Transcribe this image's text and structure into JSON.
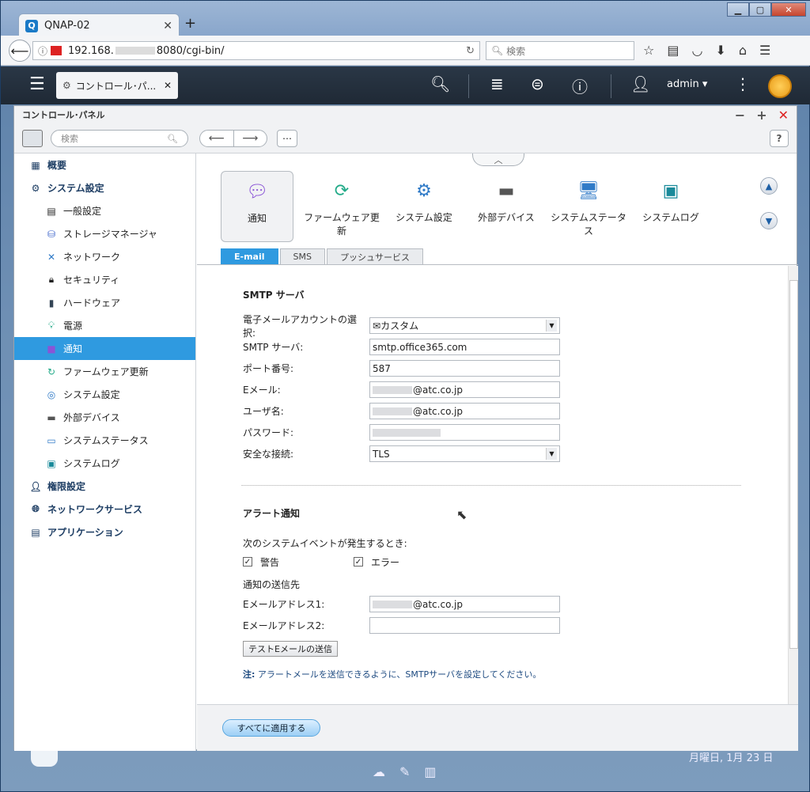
{
  "browser": {
    "tab_title": "QNAP-02",
    "url_prefix": "192.168.",
    "url_suffix": "8080/cgi-bin/",
    "search_placeholder": "検索"
  },
  "qnap": {
    "app_tab": "コントロール･パ...",
    "user": "admin ▾"
  },
  "window": {
    "title": "コントロール･パネル",
    "search_placeholder": "検索"
  },
  "sidebar": {
    "items": [
      {
        "label": "概要",
        "level": "top"
      },
      {
        "label": "システム設定",
        "level": "top"
      },
      {
        "label": "一般設定",
        "level": "sub"
      },
      {
        "label": "ストレージマネージャ",
        "level": "sub"
      },
      {
        "label": "ネットワーク",
        "level": "sub"
      },
      {
        "label": "セキュリティ",
        "level": "sub"
      },
      {
        "label": "ハードウェア",
        "level": "sub"
      },
      {
        "label": "電源",
        "level": "sub"
      },
      {
        "label": "通知",
        "level": "sub",
        "active": true
      },
      {
        "label": "ファームウェア更新",
        "level": "sub"
      },
      {
        "label": "システム設定",
        "level": "sub"
      },
      {
        "label": "外部デバイス",
        "level": "sub"
      },
      {
        "label": "システムステータス",
        "level": "sub"
      },
      {
        "label": "システムログ",
        "level": "sub"
      },
      {
        "label": "権限設定",
        "level": "top"
      },
      {
        "label": "ネットワークサービス",
        "level": "top"
      },
      {
        "label": "アプリケーション",
        "level": "top"
      }
    ]
  },
  "icons": [
    {
      "label": "通知"
    },
    {
      "label": "ファームウェア更新"
    },
    {
      "label": "システム設定"
    },
    {
      "label": "外部デバイス"
    },
    {
      "label": "システムステータス"
    },
    {
      "label": "システムログ"
    }
  ],
  "subtabs": [
    "E-mail",
    "SMS",
    "プッシュサービス"
  ],
  "smtp": {
    "title": "SMTP サーバ",
    "account_label": "電子メールアカウントの選択:",
    "account_value": "カスタム",
    "server_label": "SMTP サーバ:",
    "server_value": "smtp.office365.com",
    "port_label": "ポート番号:",
    "port_value": "587",
    "email_label": "Eメール:",
    "email_value": "@atc.co.jp",
    "user_label": "ユーザ名:",
    "user_value": "@atc.co.jp",
    "password_label": "パスワード:",
    "secure_label": "安全な接続:",
    "secure_value": "TLS"
  },
  "alert": {
    "title": "アラート通知",
    "event_text": "次のシステムイベントが発生するとき:",
    "warning": "警告",
    "error": "エラー",
    "dest_text": "通知の送信先",
    "addr1_label": "Eメールアドレス1:",
    "addr1_value": "@atc.co.jp",
    "addr2_label": "Eメールアドレス2:",
    "test_button": "テストEメールの送信",
    "note_prefix": "注:",
    "note_text": " アラートメールを送信できるように、SMTPサーバを設定してください。"
  },
  "footer": {
    "apply": "すべてに適用する"
  },
  "desktop": {
    "date": "月曜日, 1月 23 日"
  }
}
